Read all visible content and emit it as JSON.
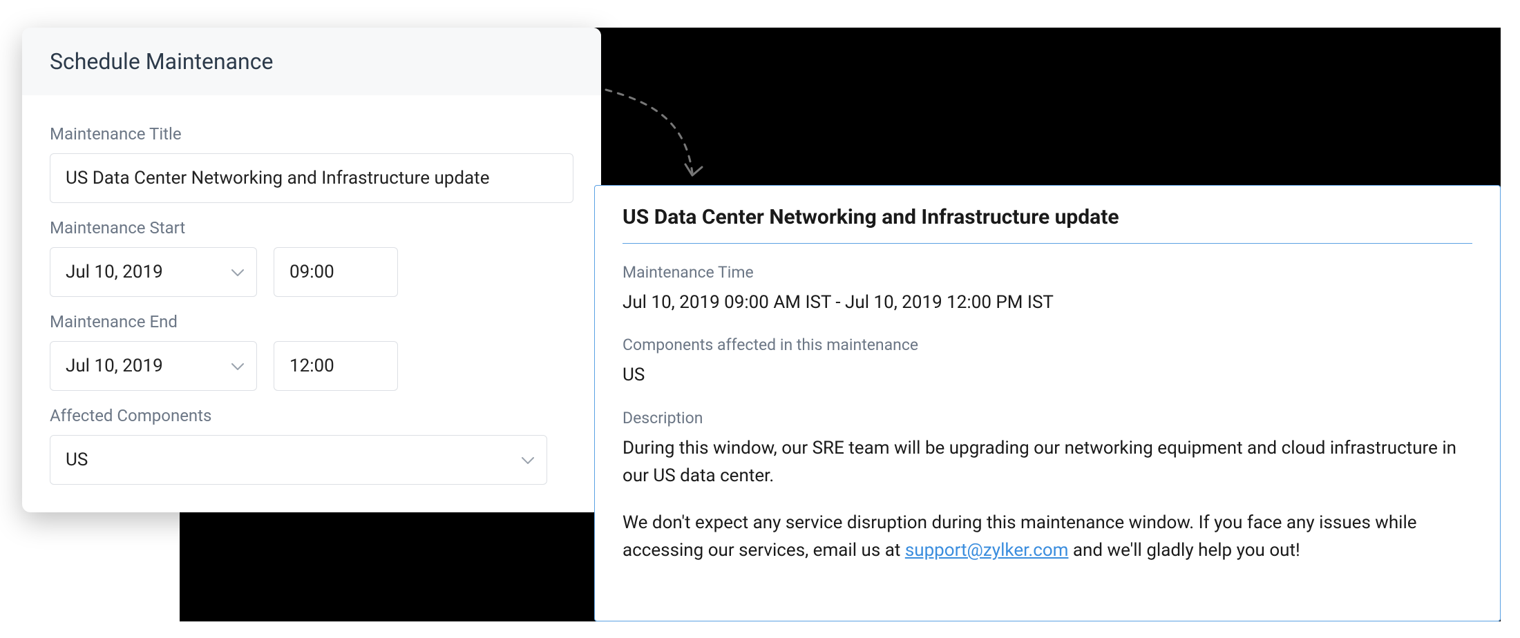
{
  "form": {
    "header": "Schedule Maintenance",
    "title_label": "Maintenance Title",
    "title_value": "US Data Center Networking and Infrastructure update",
    "start_label": "Maintenance Start",
    "start_date": "Jul 10, 2019",
    "start_time": "09:00",
    "end_label": "Maintenance End",
    "end_date": "Jul 10, 2019",
    "end_time": "12:00",
    "components_label": "Affected Components",
    "components_value": "US"
  },
  "preview": {
    "title": "US Data Center Networking and Infrastructure update",
    "time_label": "Maintenance Time",
    "time_value": "Jul 10, 2019 09:00 AM IST - Jul 10, 2019 12:00 PM IST",
    "components_label": "Components affected in this maintenance",
    "components_value": "US",
    "description_label": "Description",
    "description_p1": "During this window, our SRE team will be upgrading our networking equipment and cloud infrastructure in our US data center.",
    "description_p2_pre": "We don't expect any service disruption during this maintenance window. If you face any issues while accessing our services, email us at ",
    "description_p2_link": "support@zylker.com",
    "description_p2_post": " and we'll gladly help you out!"
  }
}
